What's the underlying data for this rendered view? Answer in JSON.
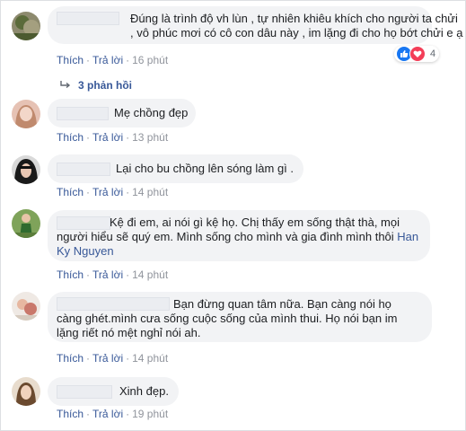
{
  "comments": [
    {
      "text": "Đúng là trình độ vh lùn , tự nhiên khiêu khích cho người ta chửi , vô phúc mơi có cô con dâu này , im lặng đi cho họ bớt chửi e ạ",
      "like": "Thích",
      "reply": "Trả lời",
      "time": "16 phút",
      "reaction_count": "4"
    },
    {
      "text": "Mẹ chồng đẹp",
      "like": "Thích",
      "reply": "Trả lời",
      "time": "13 phút"
    },
    {
      "text": "Lại cho bu chồng lên sóng làm gì .",
      "like": "Thích",
      "reply": "Trả lời",
      "time": "14 phút"
    },
    {
      "text": "Kệ đi em, ai nói gì kệ họ. Chị thấy em sống thật thà, mọi người hiểu sẽ quý em. Mình sống cho mình và gia đình mình thôi",
      "mention": "Han Ky Nguyen",
      "like": "Thích",
      "reply": "Trả lời",
      "time": "14 phút"
    },
    {
      "text": "Bạn đừng quan tâm nữa. Bạn càng nói họ càng ghét.mình cưa sống cuộc sống của mình thui. Họ nói bạn im lặng riết nó mệt nghỉ nói ah.",
      "like": "Thích",
      "reply": "Trả lời",
      "time": "14 phút"
    },
    {
      "text": "Xinh đẹp.",
      "like": "Thích",
      "reply": "Trả lời",
      "time": "19 phút"
    }
  ],
  "replies_toggle": "3 phản hồi",
  "separator": "·",
  "reaction_icons": [
    "like-icon",
    "love-icon"
  ],
  "colors": {
    "link": "#385898",
    "bubble": "#f2f3f5",
    "like": "#1877f2",
    "love": "#f33e58"
  }
}
